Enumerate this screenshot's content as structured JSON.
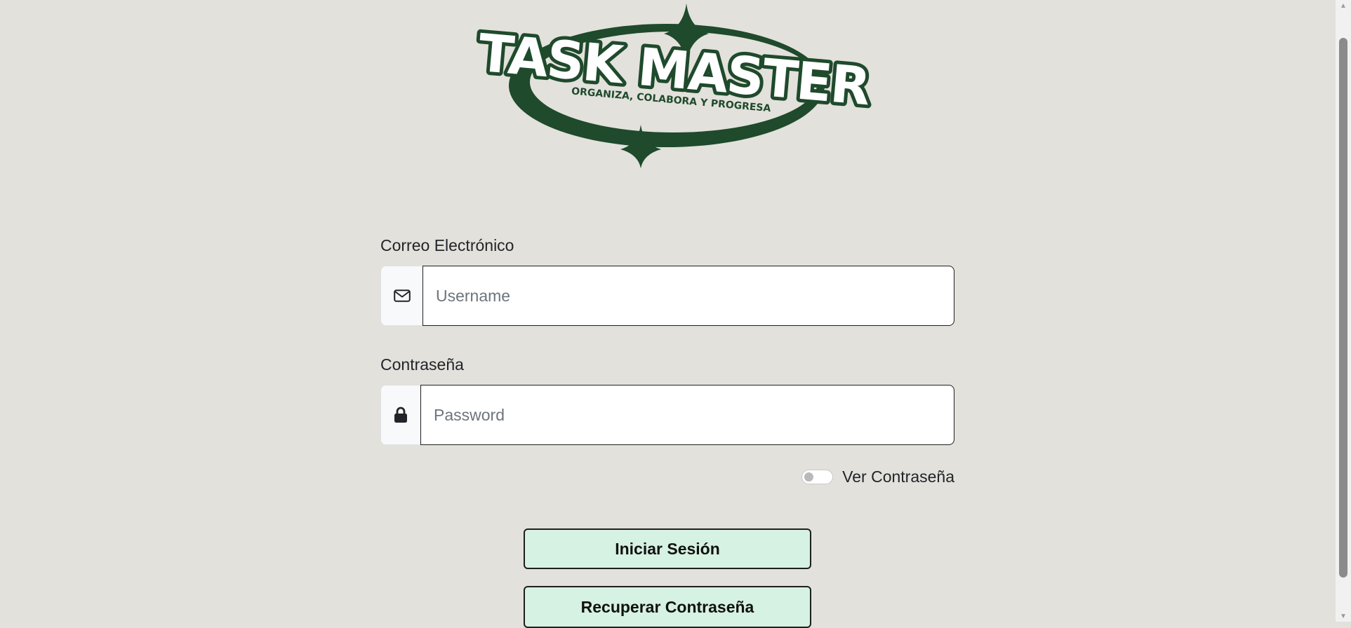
{
  "logo": {
    "title": "TASK MASTER",
    "tagline": "ORGANIZA, COLABORA Y PROGRESA"
  },
  "form": {
    "email": {
      "label": "Correo Electrónico",
      "placeholder": "Username",
      "icon": "envelope-icon"
    },
    "password": {
      "label": "Contraseña",
      "placeholder": "Password",
      "icon": "lock-icon"
    },
    "show_password": {
      "label": "Ver Contraseña",
      "checked": false
    }
  },
  "buttons": {
    "login": "Iniciar Sesión",
    "recover": "Recuperar Contraseña"
  },
  "colors": {
    "background": "#e3e1dc",
    "brand_green": "#1f4a2c",
    "button_bg": "#d6f2e2"
  }
}
